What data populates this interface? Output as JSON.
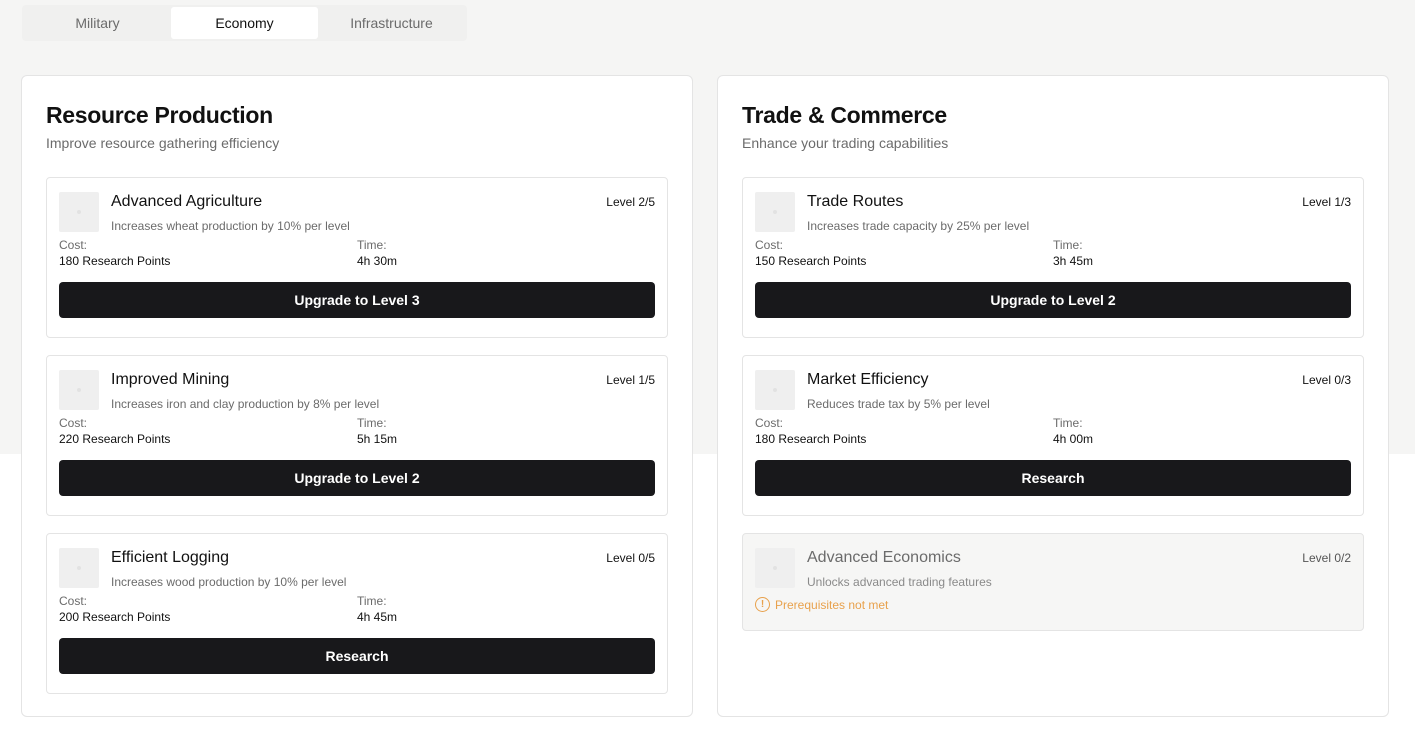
{
  "tabs": [
    {
      "label": "Military"
    },
    {
      "label": "Economy"
    },
    {
      "label": "Infrastructure"
    }
  ],
  "active_tab": "Economy",
  "panels": [
    {
      "title": "Resource Production",
      "subtitle": "Improve resource gathering efficiency",
      "cards": [
        {
          "name": "Advanced Agriculture",
          "description": "Increases wheat production by 10% per level",
          "level": "Level 2/5",
          "cost_label": "Cost:",
          "cost": "180 Research Points",
          "time_label": "Time:",
          "time": "4h 30m",
          "button": "Upgrade to Level 3"
        },
        {
          "name": "Improved Mining",
          "description": "Increases iron and clay production by 8% per level",
          "level": "Level 1/5",
          "cost_label": "Cost:",
          "cost": "220 Research Points",
          "time_label": "Time:",
          "time": "5h 15m",
          "button": "Upgrade to Level 2"
        },
        {
          "name": "Efficient Logging",
          "description": "Increases wood production by 10% per level",
          "level": "Level 0/5",
          "cost_label": "Cost:",
          "cost": "200 Research Points",
          "time_label": "Time:",
          "time": "4h 45m",
          "button": "Research"
        }
      ]
    },
    {
      "title": "Trade & Commerce",
      "subtitle": "Enhance your trading capabilities",
      "cards": [
        {
          "name": "Trade Routes",
          "description": "Increases trade capacity by 25% per level",
          "level": "Level 1/3",
          "cost_label": "Cost:",
          "cost": "150 Research Points",
          "time_label": "Time:",
          "time": "3h 45m",
          "button": "Upgrade to Level 2"
        },
        {
          "name": "Market Efficiency",
          "description": "Reduces trade tax by 5% per level",
          "level": "Level 0/3",
          "cost_label": "Cost:",
          "cost": "180 Research Points",
          "time_label": "Time:",
          "time": "4h 00m",
          "button": "Research"
        },
        {
          "name": "Advanced Economics",
          "description": "Unlocks advanced trading features",
          "level": "Level 0/2",
          "locked": true,
          "prereq_icon": "!",
          "prereq": "Prerequisites not met"
        }
      ]
    }
  ],
  "colors": {
    "button_bg": "#18181b",
    "warning": "#e8a14c",
    "page_top_bg": "#f5f5f4"
  },
  "icons": {
    "warning": "alert-circle-icon",
    "thumbnail": "image-placeholder-icon"
  }
}
